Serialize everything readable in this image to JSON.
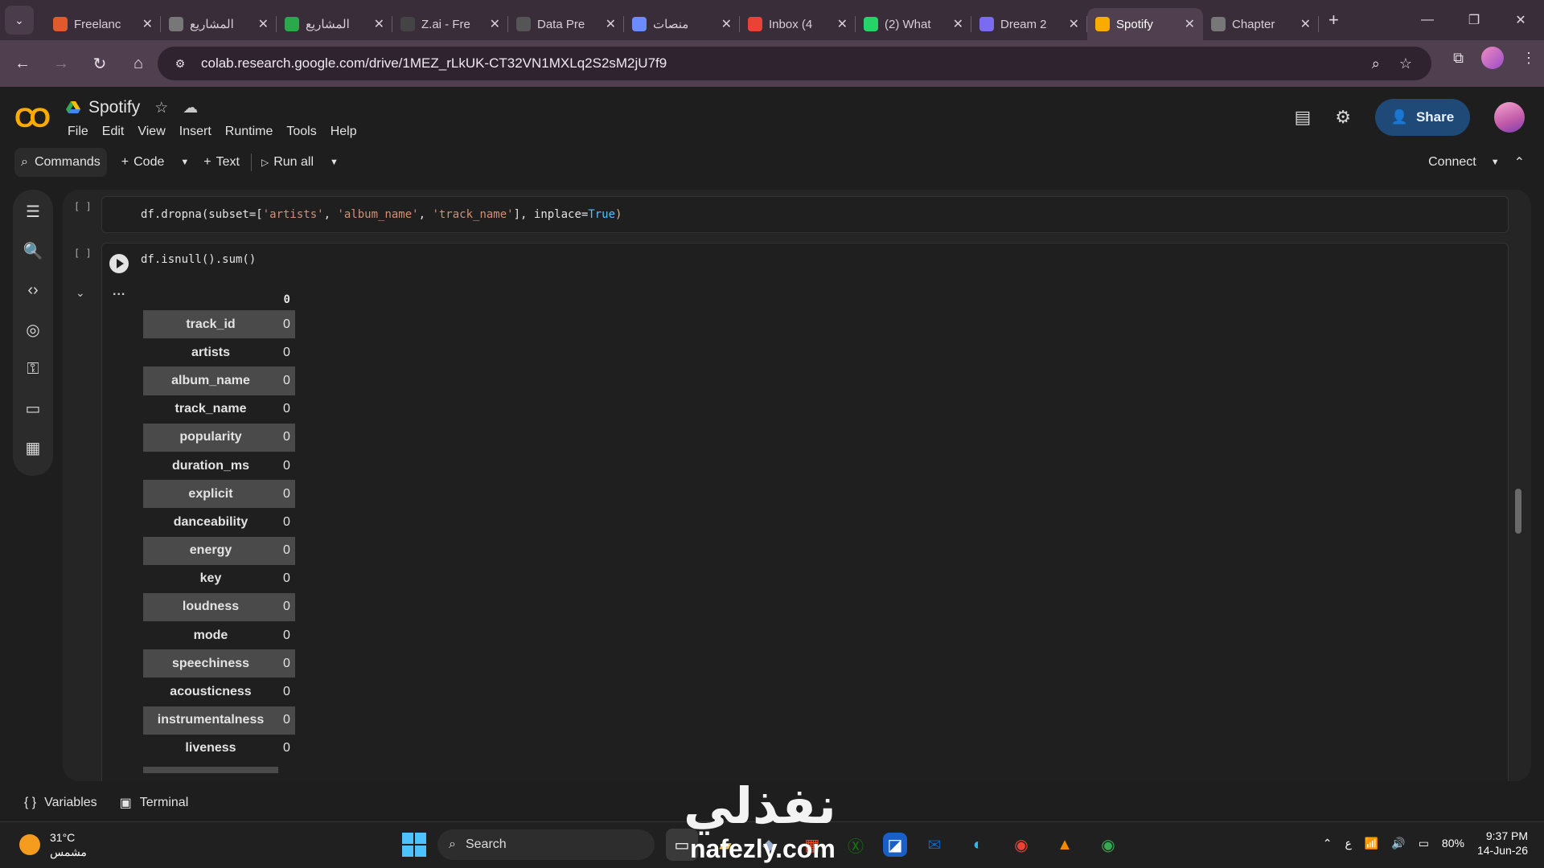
{
  "browser": {
    "tabs": [
      {
        "label": "Freelanc",
        "icon": "freelancer-icon",
        "color": "#e05a2b"
      },
      {
        "label": "المشاريع",
        "icon": "globe-icon",
        "color": "#777777"
      },
      {
        "label": "المشاريع",
        "icon": "k-icon",
        "color": "#2aa84a"
      },
      {
        "label": "Z.ai - Fre",
        "icon": "z-icon",
        "color": "#444444"
      },
      {
        "label": "Data Pre",
        "icon": "chatgpt-icon",
        "color": "#555555"
      },
      {
        "label": "منصات",
        "icon": "gemini-icon",
        "color": "#6a8cff"
      },
      {
        "label": "Inbox (4",
        "icon": "gmail-icon",
        "color": "#ea4335"
      },
      {
        "label": "(2) What",
        "icon": "whatsapp-icon",
        "color": "#25d366"
      },
      {
        "label": "Dream 2",
        "icon": "dream-icon",
        "color": "#7a6cf0"
      },
      {
        "label": "Spotify",
        "icon": "colab-icon",
        "color": "#f9ab00"
      },
      {
        "label": "Chapter",
        "icon": "globe-icon",
        "color": "#777777"
      }
    ],
    "active_tab": 9,
    "url": "colab.research.google.com/drive/1MEZ_rLkUK-CT32VN1MXLq2S2sM2jU7f9"
  },
  "colab": {
    "logo": "CO",
    "title": "Spotify",
    "menus": [
      "File",
      "Edit",
      "View",
      "Insert",
      "Runtime",
      "Tools",
      "Help"
    ],
    "share_label": "Share",
    "toolbar": {
      "commands": "Commands",
      "code": "Code",
      "text": "Text",
      "run_all": "Run all",
      "connect": "Connect"
    }
  },
  "cells": [
    {
      "exec": "[ ]",
      "code_parts": {
        "a": "df.dropna(subset=[",
        "b": "'artists'",
        "c": ", ",
        "d": "'album_name'",
        "e": ", ",
        "f": "'track_name'",
        "g": "], inplace=",
        "h": "True",
        "i": ")"
      }
    },
    {
      "exec": "[ ]",
      "code": "df.isnull().sum()"
    }
  ],
  "output": {
    "header": "0",
    "ellipsis": "...",
    "rows": [
      {
        "name": "track_id",
        "value": "0"
      },
      {
        "name": "artists",
        "value": "0"
      },
      {
        "name": "album_name",
        "value": "0"
      },
      {
        "name": "track_name",
        "value": "0"
      },
      {
        "name": "popularity",
        "value": "0"
      },
      {
        "name": "duration_ms",
        "value": "0"
      },
      {
        "name": "explicit",
        "value": "0"
      },
      {
        "name": "danceability",
        "value": "0"
      },
      {
        "name": "energy",
        "value": "0"
      },
      {
        "name": "key",
        "value": "0"
      },
      {
        "name": "loudness",
        "value": "0"
      },
      {
        "name": "mode",
        "value": "0"
      },
      {
        "name": "speechiness",
        "value": "0"
      },
      {
        "name": "acousticness",
        "value": "0"
      },
      {
        "name": "instrumentalness",
        "value": "0"
      },
      {
        "name": "liveness",
        "value": "0"
      }
    ]
  },
  "bottom": {
    "variables": "Variables",
    "terminal": "Terminal"
  },
  "taskbar": {
    "temp": "31°C",
    "condition": "مشمس",
    "search": "Search",
    "battery": "80%",
    "lang": "ع",
    "time": "9:37 PM",
    "date": "14-Jun-26"
  },
  "watermark": {
    "arabic": "نفذلي",
    "latin": "nafezly.com"
  }
}
